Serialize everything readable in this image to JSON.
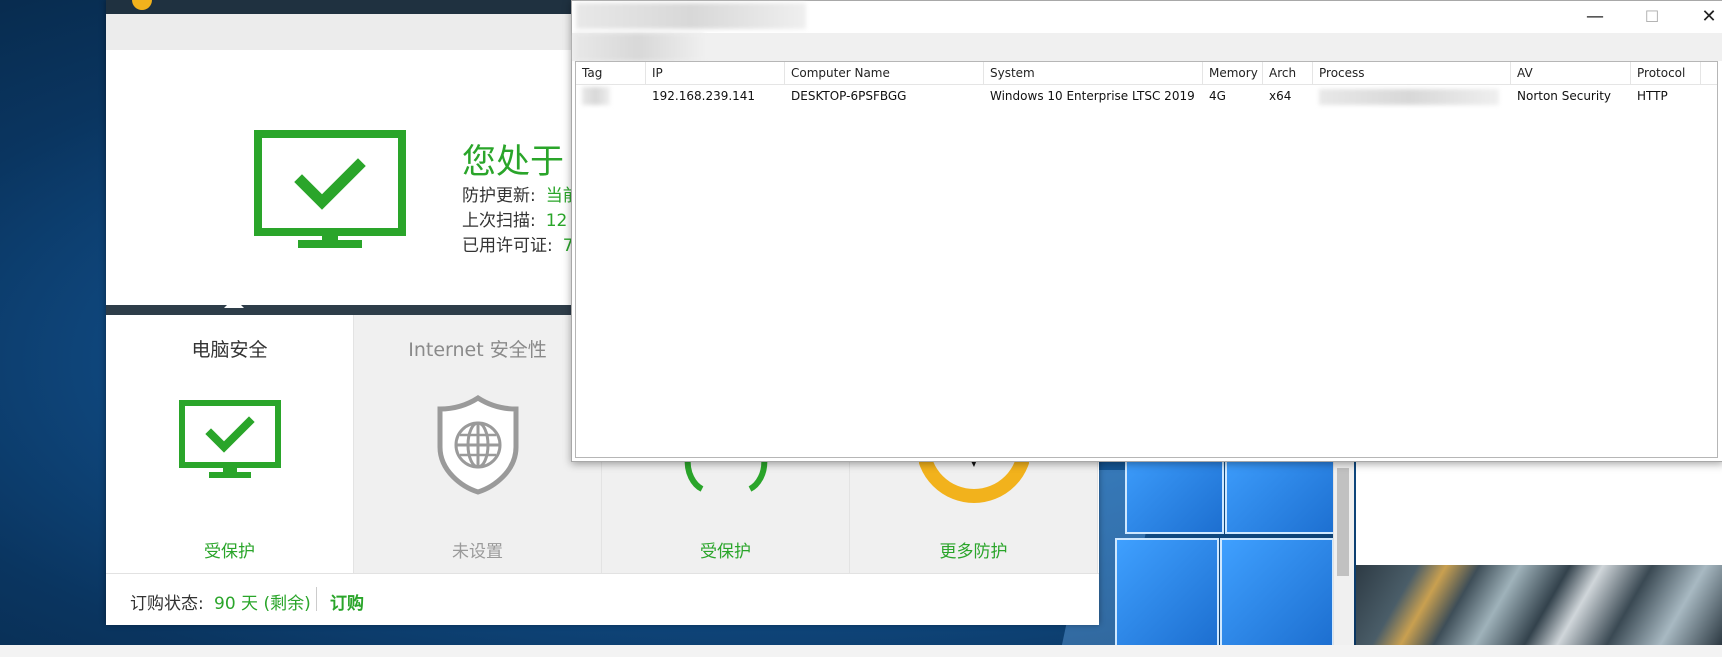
{
  "norton": {
    "status_title": "您处于",
    "info": [
      {
        "label": "防护更新:",
        "value": "当前"
      },
      {
        "label": "上次扫描:",
        "value": "12"
      },
      {
        "label": "已用许可证:",
        "value": "7"
      }
    ],
    "tiles": [
      {
        "title": "电脑安全",
        "status": "受保护",
        "icon": "monitor-check-icon"
      },
      {
        "title": "Internet 安全性",
        "status": "未设置",
        "icon": "globe-shield-icon"
      },
      {
        "title": "",
        "status": "受保护",
        "icon": "refresh-arrows-icon"
      },
      {
        "title": "",
        "status": "更多防护",
        "icon": "norton-check-badge-icon"
      }
    ],
    "footer": {
      "label": "订购状态:",
      "days": "90 天 (剩余)",
      "subscribe": "订购"
    },
    "colors": {
      "green": "#2aa52a",
      "dark": "#1f3140",
      "yellow": "#f2b21c"
    }
  },
  "listing": {
    "controls": {
      "minimize": "—",
      "maximize": "☐",
      "close": "✕"
    },
    "columns": [
      "Tag",
      "IP",
      "Computer Name",
      "System",
      "Memory",
      "Arch",
      "Process",
      "AV",
      "Protocol"
    ],
    "rows": [
      {
        "tag": "",
        "ip": "192.168.239.141",
        "computer_name": "DESKTOP-6PSFBGG",
        "system": "Windows 10 Enterprise LTSC 2019",
        "memory": "4G",
        "arch": "x64",
        "process": "",
        "av": "Norton Security",
        "protocol": "HTTP"
      }
    ]
  }
}
